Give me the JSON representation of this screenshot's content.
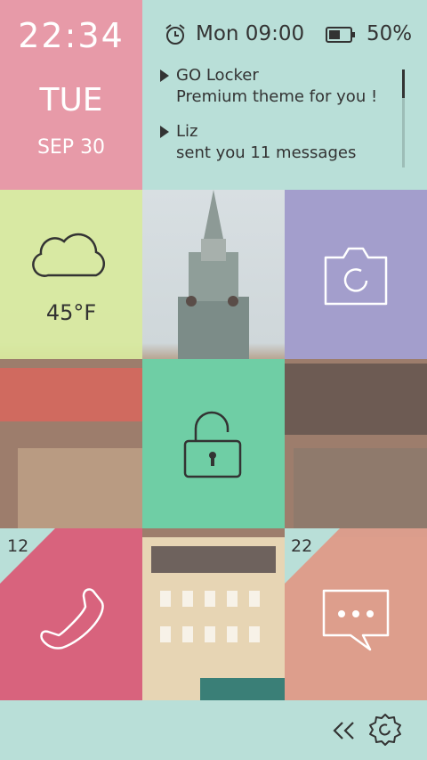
{
  "clock": {
    "time": "22:34",
    "day": "TUE",
    "date": "SEP 30"
  },
  "status": {
    "alarm_icon": "alarm-clock-icon",
    "alarm_text": "Mon 09:00",
    "battery_icon": "battery-icon",
    "battery_text": "50%"
  },
  "notifications": [
    {
      "title": "GO Locker",
      "body": "Premium theme for you !"
    },
    {
      "title": "Liz",
      "body": "sent you 11 messages"
    }
  ],
  "weather": {
    "icon": "cloud-icon",
    "temp": "45°F"
  },
  "tiles": {
    "camera_icon": "camera-icon",
    "unlock_icon": "unlock-icon",
    "phone_icon": "phone-icon",
    "phone_badge": "12",
    "message_icon": "message-icon",
    "message_badge": "22"
  },
  "bottom": {
    "back_icon": "double-chevron-left-icon",
    "settings_icon": "gear-icon"
  },
  "colors": {
    "pink": "#e79aa8",
    "mint": "#b9dfd8",
    "lime": "#d8ea9c",
    "lavender": "#a39ecc",
    "green": "#6fcea5",
    "magenta": "#e0607f",
    "salmon": "#e9a392"
  }
}
